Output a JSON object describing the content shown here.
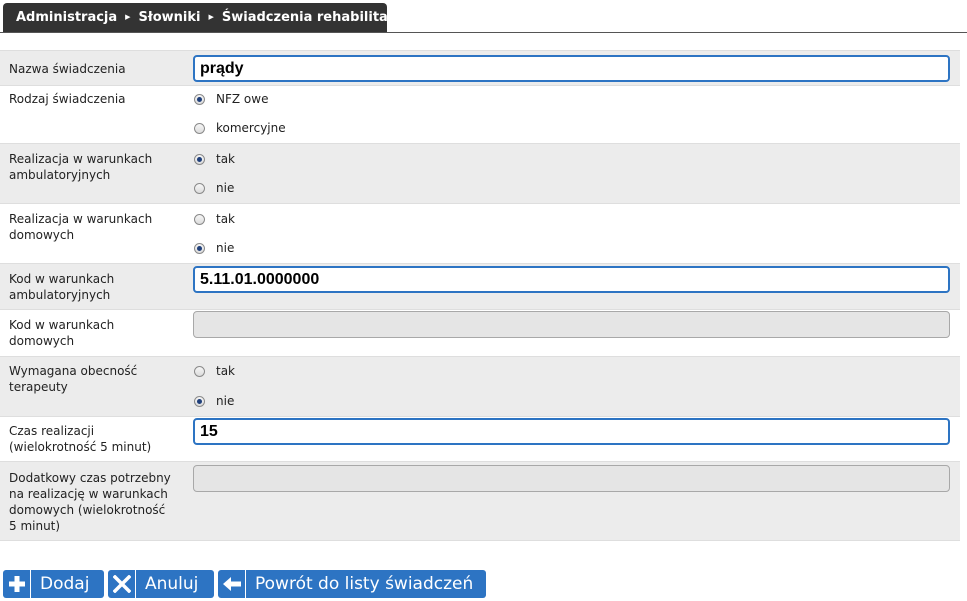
{
  "breadcrumb": {
    "items": [
      "Administracja",
      "Słowniki",
      "Świadczenia rehabilitacyjne"
    ]
  },
  "form": {
    "name": {
      "label": "Nazwa świadczenia",
      "value": "prądy"
    },
    "type": {
      "label": "Rodzaj świadczenia",
      "options": [
        "NFZ owe",
        "komercyjne"
      ],
      "selected": "NFZ owe"
    },
    "ambulatory": {
      "label": "Realizacja w warunkach ambulatoryjnych",
      "options": [
        "tak",
        "nie"
      ],
      "selected": "tak"
    },
    "home": {
      "label": "Realizacja w warunkach domowych",
      "options": [
        "tak",
        "nie"
      ],
      "selected": "nie"
    },
    "code_ambulatory": {
      "label": "Kod w warunkach ambulatoryjnych",
      "value": "5.11.01.0000000"
    },
    "code_home": {
      "label": "Kod w warunkach domowych",
      "value": ""
    },
    "therapist": {
      "label": "Wymagana obecność terapeuty",
      "options": [
        "tak",
        "nie"
      ],
      "selected": "nie"
    },
    "duration": {
      "label": "Czas realizacji (wielokrotność 5 minut)",
      "value": "15"
    },
    "extra_time": {
      "label": "Dodatkowy czas potrzebny na realizację w warunkach domowych (wielokrotność 5 minut)",
      "value": ""
    }
  },
  "buttons": {
    "add": "Dodaj",
    "cancel": "Anuluj",
    "back": "Powrót do listy świadczeń"
  },
  "colors": {
    "accent": "#2d74c3",
    "tab": "#333333",
    "row_shade": "#ececec"
  }
}
